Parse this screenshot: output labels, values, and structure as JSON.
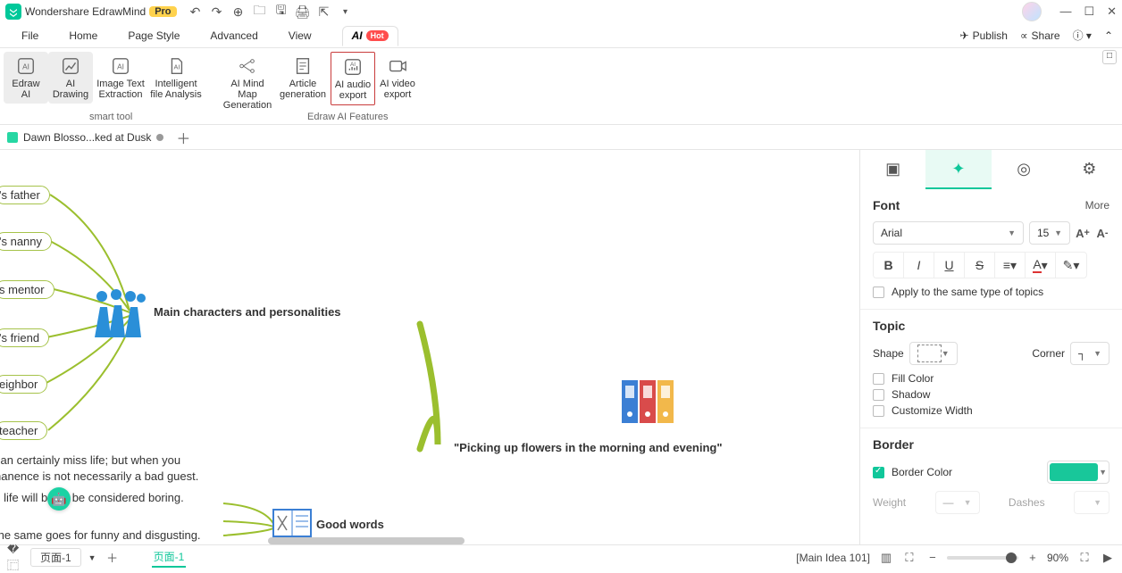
{
  "app": {
    "name": "Wondershare EdrawMind",
    "badge": "Pro"
  },
  "qat": [
    "undo",
    "redo",
    "new",
    "open",
    "save",
    "print",
    "export",
    "dropdown"
  ],
  "window": [
    "min",
    "max",
    "close"
  ],
  "menu": {
    "items": [
      "File",
      "Home",
      "Page Style",
      "Advanced",
      "View"
    ],
    "ai": "AI",
    "hot": "Hot",
    "right": {
      "publish": "Publish",
      "share": "Share"
    }
  },
  "ribbon": {
    "tools": [
      {
        "l1": "Edraw",
        "l2": "AI"
      },
      {
        "l1": "AI",
        "l2": "Drawing"
      },
      {
        "l1": "Image Text",
        "l2": "Extraction"
      },
      {
        "l1": "Intelligent",
        "l2": "file Analysis"
      },
      {
        "l1": "AI Mind Map",
        "l2": "Generation"
      },
      {
        "l1": "Article",
        "l2": "generation"
      },
      {
        "l1": "AI audio",
        "l2": "export"
      },
      {
        "l1": "AI video",
        "l2": "export"
      }
    ],
    "group1": "smart tool",
    "group2": "Edraw AI Features"
  },
  "doc": {
    "name": "Dawn Blosso...ked at Dusk"
  },
  "canvas": {
    "nodes": [
      "'s father",
      "'s nanny",
      "s mentor",
      "'s friend",
      "eighbor",
      "teacher"
    ],
    "main_chars": "Main characters and personalities",
    "good_words": "Good words",
    "title": "\"Picking up flowers in the morning and evening\"",
    "para": [
      "can certainly miss life; but when you",
      "nanence is not necessarily a bad guest.",
      "s life will       bably be considered boring.",
      "the same goes for funny and disgusting."
    ]
  },
  "side": {
    "font": {
      "title": "Font",
      "more": "More",
      "family": "Arial",
      "size": "15",
      "apply": "Apply to the same type of topics"
    },
    "topic": {
      "title": "Topic",
      "shape": "Shape",
      "corner": "Corner",
      "fill": "Fill Color",
      "shadow": "Shadow",
      "custom": "Customize Width"
    },
    "border": {
      "title": "Border",
      "color": "Border Color",
      "weight": "Weight",
      "dashes": "Dashes"
    }
  },
  "status": {
    "page_sel": "页面-1",
    "page_tab": "页面-1",
    "context": "[Main Idea 101]",
    "zoom": "90%"
  }
}
